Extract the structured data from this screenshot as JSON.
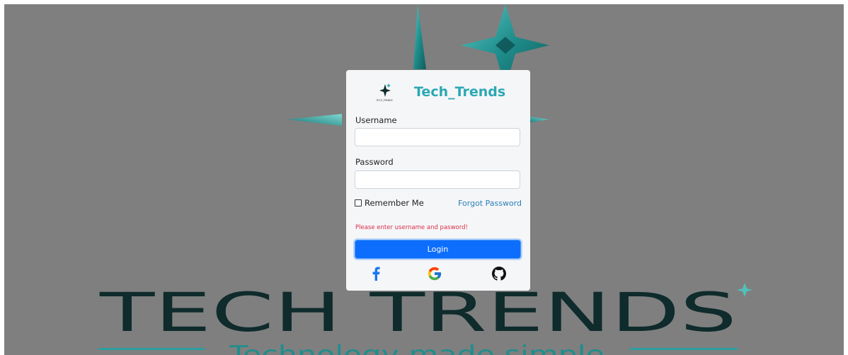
{
  "brand": {
    "title": "Tech_Trends",
    "logo_text": "TECH_TRENDS"
  },
  "background": {
    "headline": "TECH TRENDS",
    "tagline": "Technology made simple"
  },
  "form": {
    "username_label": "Username",
    "username_value": "",
    "password_label": "Password",
    "password_value": "",
    "remember_label": "Remember Me",
    "remember_checked": false,
    "forgot_label": "Forgot Password",
    "error_message": "Please enter username and pasword!",
    "login_label": "Login"
  },
  "social": [
    {
      "icon": "facebook-icon",
      "label": "f"
    },
    {
      "icon": "google-icon",
      "label": "G"
    },
    {
      "icon": "github-icon"
    }
  ],
  "colors": {
    "backdrop": "#7f7f7f",
    "brand_teal": "#2ba9b4",
    "headline_dark": "#0f2b2c",
    "primary_button": "#0d6efd",
    "error": "#d9304a",
    "link": "#2b7fb8",
    "facebook": "#1877f2"
  }
}
